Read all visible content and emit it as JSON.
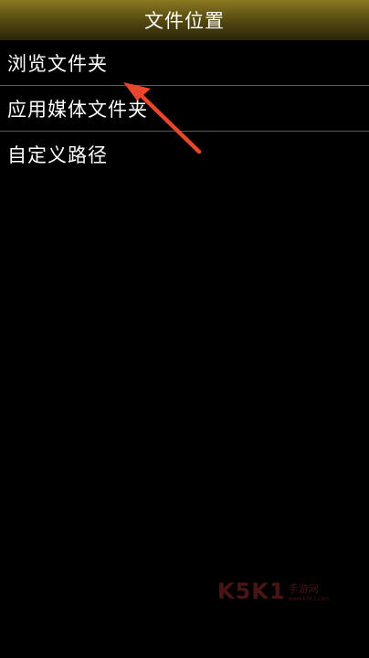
{
  "header": {
    "title": "文件位置"
  },
  "menu": {
    "items": [
      {
        "label": "浏览文件夹"
      },
      {
        "label": "应用媒体文件夹"
      },
      {
        "label": "自定义路径"
      }
    ]
  },
  "annotation": {
    "arrow_color": "#e8472b",
    "arrow_icon": "pointer-arrow-icon"
  },
  "watermark": {
    "logo": "K5K1",
    "name": "手游网",
    "url": "www.k5k1.com"
  },
  "colors": {
    "background": "#000000",
    "title_bar": "#6b5d18",
    "divider": "#5a5a5a",
    "text": "#ffffff"
  }
}
